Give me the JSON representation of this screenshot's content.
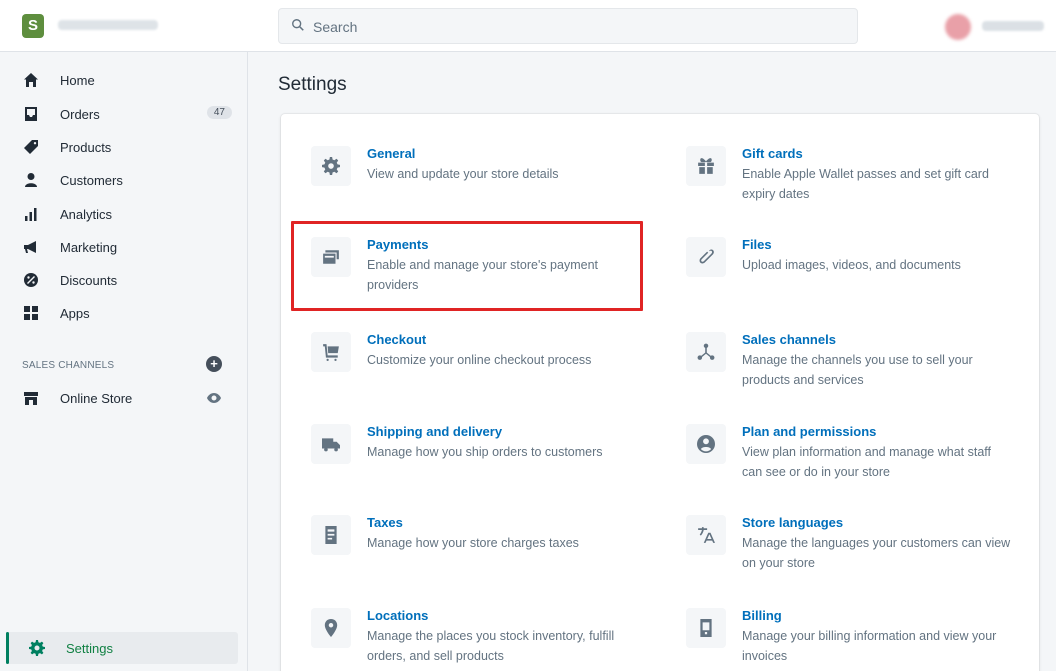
{
  "topbar": {
    "search_placeholder": "Search"
  },
  "sidebar": {
    "items": [
      {
        "label": "Home",
        "icon": "home-icon"
      },
      {
        "label": "Orders",
        "icon": "orders-icon",
        "badge": "47"
      },
      {
        "label": "Products",
        "icon": "tag-icon"
      },
      {
        "label": "Customers",
        "icon": "person-icon"
      },
      {
        "label": "Analytics",
        "icon": "bar-chart-icon"
      },
      {
        "label": "Marketing",
        "icon": "megaphone-icon"
      },
      {
        "label": "Discounts",
        "icon": "discount-icon"
      },
      {
        "label": "Apps",
        "icon": "apps-icon"
      }
    ],
    "sales_channels_title": "SALES CHANNELS",
    "online_store_label": "Online Store",
    "settings_label": "Settings"
  },
  "main": {
    "title": "Settings",
    "settings": [
      {
        "title": "General",
        "desc": "View and update your store details",
        "icon": "gear-icon"
      },
      {
        "title": "Gift cards",
        "desc": "Enable Apple Wallet passes and set gift card expiry dates",
        "icon": "gift-icon"
      },
      {
        "title": "Payments",
        "desc": "Enable and manage your store's payment providers",
        "icon": "credit-card-icon"
      },
      {
        "title": "Files",
        "desc": "Upload images, videos, and documents",
        "icon": "paperclip-icon"
      },
      {
        "title": "Checkout",
        "desc": "Customize your online checkout process",
        "icon": "cart-icon"
      },
      {
        "title": "Sales channels",
        "desc": "Manage the channels you use to sell your products and services",
        "icon": "channels-icon"
      },
      {
        "title": "Shipping and delivery",
        "desc": "Manage how you ship orders to customers",
        "icon": "truck-icon"
      },
      {
        "title": "Plan and permissions",
        "desc": "View plan information and manage what staff can see or do in your store",
        "icon": "account-icon"
      },
      {
        "title": "Taxes",
        "desc": "Manage how your store charges taxes",
        "icon": "receipt-icon"
      },
      {
        "title": "Store languages",
        "desc": "Manage the languages your customers can view on your store",
        "icon": "translate-icon"
      },
      {
        "title": "Locations",
        "desc": "Manage the places you stock inventory, fulfill orders, and sell products",
        "icon": "location-pin-icon"
      },
      {
        "title": "Billing",
        "desc": "Manage your billing information and view your invoices",
        "icon": "billing-icon"
      }
    ]
  },
  "colors": {
    "accent_link": "#006fbb",
    "active_nav": "#008060",
    "highlight_box": "#e02424"
  }
}
